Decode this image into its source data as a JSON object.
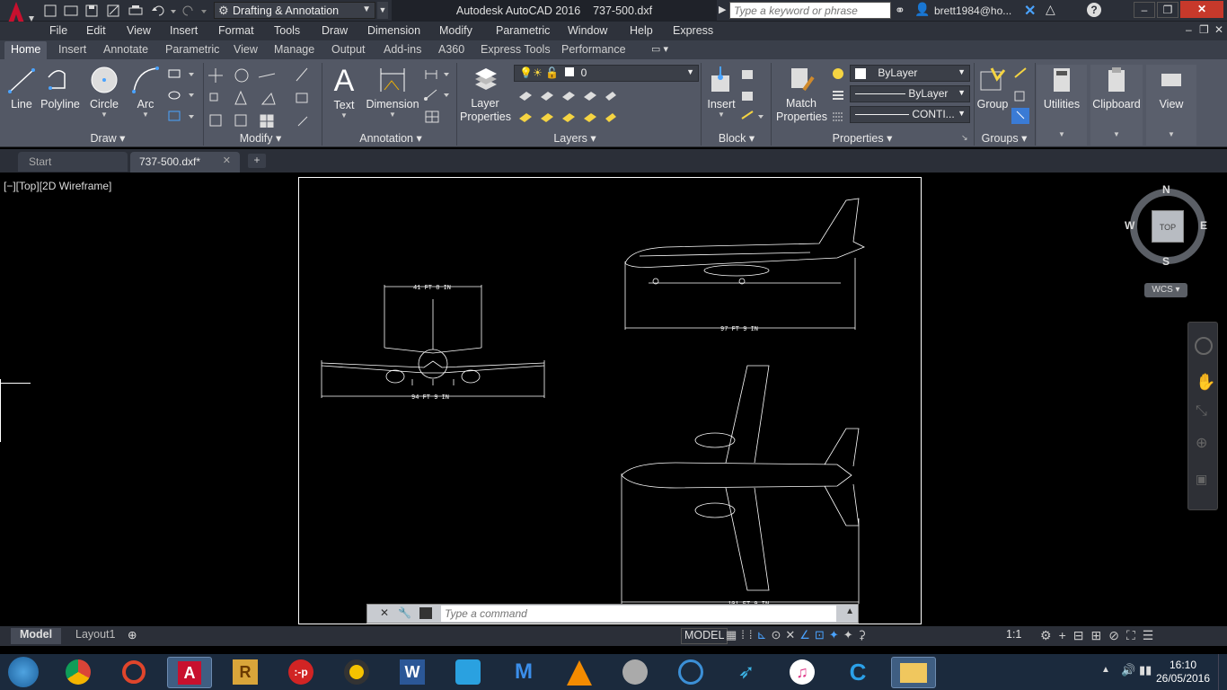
{
  "app": {
    "title": "Autodesk AutoCAD 2016",
    "filename": "737-500.dxf",
    "workspace": "Drafting & Annotation",
    "search_placeholder": "Type a keyword or phrase",
    "user": "brett1984@ho..."
  },
  "menu": [
    "File",
    "Edit",
    "View",
    "Insert",
    "Format",
    "Tools",
    "Draw",
    "Dimension",
    "Modify",
    "Parametric",
    "Window",
    "Help",
    "Express"
  ],
  "ribbon_tabs": [
    "Home",
    "Insert",
    "Annotate",
    "Parametric",
    "View",
    "Manage",
    "Output",
    "Add-ins",
    "A360",
    "Express Tools",
    "Performance"
  ],
  "draw": {
    "line": "Line",
    "polyline": "Polyline",
    "circle": "Circle",
    "arc": "Arc",
    "panel": "Draw"
  },
  "modify": {
    "panel": "Modify"
  },
  "annotation": {
    "text": "Text",
    "dimension": "Dimension",
    "panel": "Annotation"
  },
  "layers": {
    "properties_line1": "Layer",
    "properties_line2": "Properties",
    "current": "0",
    "panel": "Layers"
  },
  "block": {
    "insert": "Insert",
    "panel": "Block"
  },
  "properties": {
    "match_line1": "Match",
    "match_line2": "Properties",
    "color": "ByLayer",
    "lineweight": "ByLayer",
    "linetype": "CONTI...",
    "panel": "Properties"
  },
  "groups": {
    "group": "Group",
    "panel": "Groups"
  },
  "utilities": "Utilities",
  "clipboard": "Clipboard",
  "view": "View",
  "doc_tabs": [
    {
      "label": "Start"
    },
    {
      "label": "737-500.dxf*"
    }
  ],
  "viewport_label": "[−][Top][2D Wireframe]",
  "viewcube": {
    "n": "N",
    "s": "S",
    "e": "E",
    "w": "W",
    "face": "TOP",
    "wcs": "WCS"
  },
  "dims": {
    "front_span": "94 FT 9 IN",
    "front_height": "41 FT 8 IN",
    "side_length": "97 FT 9 IN",
    "top_length": "101 FT 9 IN"
  },
  "command": {
    "placeholder": "Type a command"
  },
  "layout_tabs": [
    "Model",
    "Layout1"
  ],
  "status": {
    "model": "MODEL",
    "scale": "1:1"
  },
  "clock": {
    "time": "16:10",
    "date": "26/05/2016"
  },
  "colors": {
    "accent": "#c8102e",
    "ribbon": "#535865",
    "canvas": "#000000"
  }
}
